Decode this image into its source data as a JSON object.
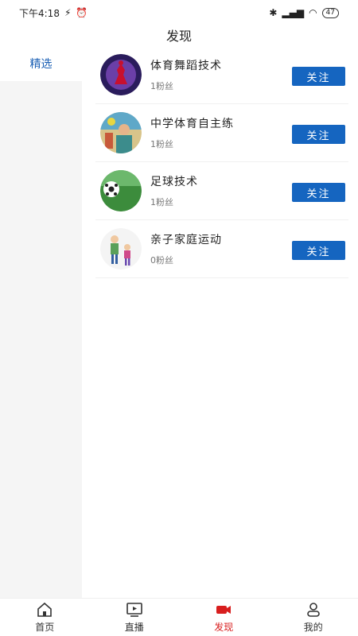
{
  "status_bar": {
    "time": "下午4:18",
    "battery": "47"
  },
  "title": "发现",
  "sidebar": {
    "items": [
      {
        "label": "精选"
      }
    ]
  },
  "channels": [
    {
      "name": "体育舞蹈技术",
      "fans": "1粉丝",
      "follow_label": "关注",
      "avatar_icon": "dance-avatar-icon"
    },
    {
      "name": "中学体育自主练",
      "fans": "1粉丝",
      "follow_label": "关注",
      "avatar_icon": "teacher-avatar-icon"
    },
    {
      "name": "足球技术",
      "fans": "1粉丝",
      "follow_label": "关注",
      "avatar_icon": "soccer-avatar-icon"
    },
    {
      "name": "亲子家庭运动",
      "fans": "0粉丝",
      "follow_label": "关注",
      "avatar_icon": "family-avatar-icon"
    }
  ],
  "tabbar": {
    "items": [
      {
        "label": "首页",
        "icon": "home-icon"
      },
      {
        "label": "直播",
        "icon": "tv-icon"
      },
      {
        "label": "发现",
        "icon": "video-camera-icon"
      },
      {
        "label": "我的",
        "icon": "user-icon"
      }
    ],
    "active_color": "#d81e1e"
  },
  "colors": {
    "accent": "#1565c0",
    "sidebar_bg": "#f5f5f5",
    "selected_text": "#1a5fb4"
  }
}
